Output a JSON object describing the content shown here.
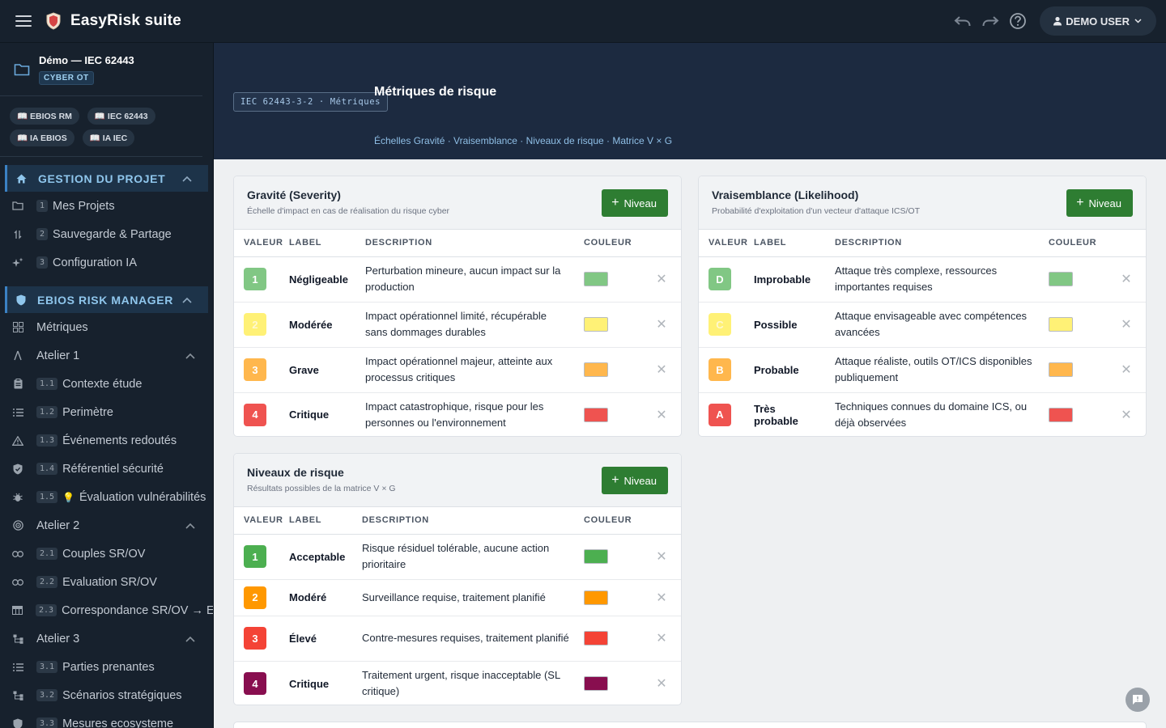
{
  "app": {
    "title": "EasyRisk suite",
    "user": "DEMO USER"
  },
  "project": {
    "name": "Démo — IEC 62443",
    "badge": "CYBER OT"
  },
  "refs": [
    "📖 EBIOS RM",
    "📖 IEC 62443",
    "📖 IA EBIOS",
    "📖 IA IEC"
  ],
  "sidebar": {
    "section1": {
      "label": "GESTION DU PROJET",
      "items": [
        {
          "num": "1",
          "label": "Mes Projets"
        },
        {
          "num": "2",
          "label": "Sauvegarde & Partage"
        },
        {
          "num": "3",
          "label": "Configuration IA"
        }
      ]
    },
    "section2": {
      "label": "EBIOS RISK MANAGER"
    },
    "metriques": "Métriques",
    "atelier1": {
      "label": "Atelier 1",
      "items": [
        {
          "num": "1.1",
          "label": "Contexte étude"
        },
        {
          "num": "1.2",
          "label": "Perimètre"
        },
        {
          "num": "1.3",
          "label": "Événements redoutés"
        },
        {
          "num": "1.4",
          "label": "Référentiel sécurité"
        },
        {
          "num": "1.5",
          "label": "Évaluation vulnérabilités"
        }
      ]
    },
    "atelier2": {
      "label": "Atelier 2",
      "items": [
        {
          "num": "2.1",
          "label": "Couples SR/OV"
        },
        {
          "num": "2.2",
          "label": "Evaluation SR/OV"
        },
        {
          "num": "2.3",
          "label": "Correspondance SR/OV → EI"
        }
      ]
    },
    "atelier3": {
      "label": "Atelier 3",
      "items": [
        {
          "num": "3.1",
          "label": "Parties prenantes"
        },
        {
          "num": "3.2",
          "label": "Scénarios stratégiques"
        },
        {
          "num": "3.3",
          "label": "Mesures ecosysteme"
        }
      ]
    }
  },
  "hero": {
    "chip": "IEC 62443-3-2 · Métriques",
    "title": "Métriques de risque",
    "links": "Échelles Gravité · Vraisemblance · Niveaux de risque · Matrice V × G"
  },
  "columns": {
    "value": "VALEUR",
    "label": "LABEL",
    "description": "DESCRIPTION",
    "color": "COULEUR"
  },
  "add_label": "Niveau",
  "severity": {
    "title": "Gravité (Severity)",
    "subtitle": "Échelle d'impact en cas de réalisation du risque cyber",
    "rows": [
      {
        "value": "1",
        "label": "Négligeable",
        "description": "Perturbation mineure, aucun impact sur la production",
        "color": "#81c784"
      },
      {
        "value": "2",
        "label": "Modérée",
        "description": "Impact opérationnel limité, récupérable sans dommages durables",
        "color": "#fff176"
      },
      {
        "value": "3",
        "label": "Grave",
        "description": "Impact opérationnel majeur, atteinte aux processus critiques",
        "color": "#ffb74d"
      },
      {
        "value": "4",
        "label": "Critique",
        "description": "Impact catastrophique, risque pour les personnes ou l'environnement",
        "color": "#ef5350"
      }
    ]
  },
  "likelihood": {
    "title": "Vraisemblance (Likelihood)",
    "subtitle": "Probabilité d'exploitation d'un vecteur d'attaque ICS/OT",
    "rows": [
      {
        "value": "D",
        "label": "Improbable",
        "description": "Attaque très complexe, ressources importantes requises",
        "color": "#81c784"
      },
      {
        "value": "C",
        "label": "Possible",
        "description": "Attaque envisageable avec compétences avancées",
        "color": "#fff176"
      },
      {
        "value": "B",
        "label": "Probable",
        "description": "Attaque réaliste, outils OT/ICS disponibles publiquement",
        "color": "#ffb74d"
      },
      {
        "value": "A",
        "label": "Très probable",
        "description": "Techniques connues du domaine ICS, ou déjà observées",
        "color": "#ef5350"
      }
    ]
  },
  "risk": {
    "title": "Niveaux de risque",
    "subtitle": "Résultats possibles de la matrice V × G",
    "rows": [
      {
        "value": "1",
        "label": "Acceptable",
        "description": "Risque résiduel tolérable, aucune action prioritaire",
        "color": "#4caf50"
      },
      {
        "value": "2",
        "label": "Modéré",
        "description": "Surveillance requise, traitement planifié",
        "color": "#ff9800"
      },
      {
        "value": "3",
        "label": "Élevé",
        "description": "Contre-mesures requises, traitement planifié",
        "color": "#f44336"
      },
      {
        "value": "4",
        "label": "Critique",
        "description": "Traitement urgent, risque inacceptable (SL critique)",
        "color": "#880e4f"
      }
    ]
  }
}
